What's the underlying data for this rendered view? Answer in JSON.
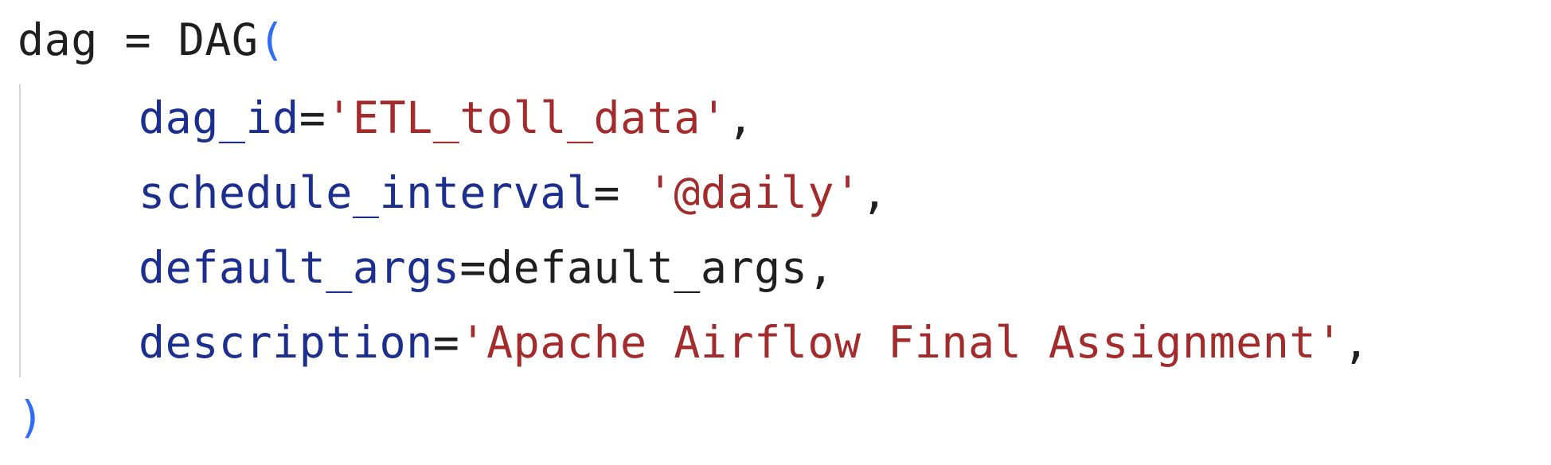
{
  "code": {
    "line1": {
      "var_name": "dag",
      "assign": " = ",
      "func_name": "DAG",
      "open_paren": "("
    },
    "line2": {
      "param": "dag_id",
      "equals": "=",
      "value": "'ETL_toll_data'",
      "comma": ","
    },
    "line3": {
      "param": "schedule_interval",
      "equals": "= ",
      "value": "'@daily'",
      "comma": ","
    },
    "line4": {
      "param": "default_args",
      "equals": "=",
      "value": "default_args",
      "comma": ","
    },
    "line5": {
      "param": "description",
      "equals": "=",
      "value": "'Apache Airflow Final Assignment'",
      "comma": ","
    },
    "line6": {
      "close_paren": ")"
    }
  },
  "colors": {
    "default_text": "#1f1f1f",
    "parenthesis": "#2f6df6",
    "parameter": "#1d2f8e",
    "string_literal": "#a32b2b",
    "indent_guide": "#d6d6d6",
    "background": "#ffffff"
  }
}
